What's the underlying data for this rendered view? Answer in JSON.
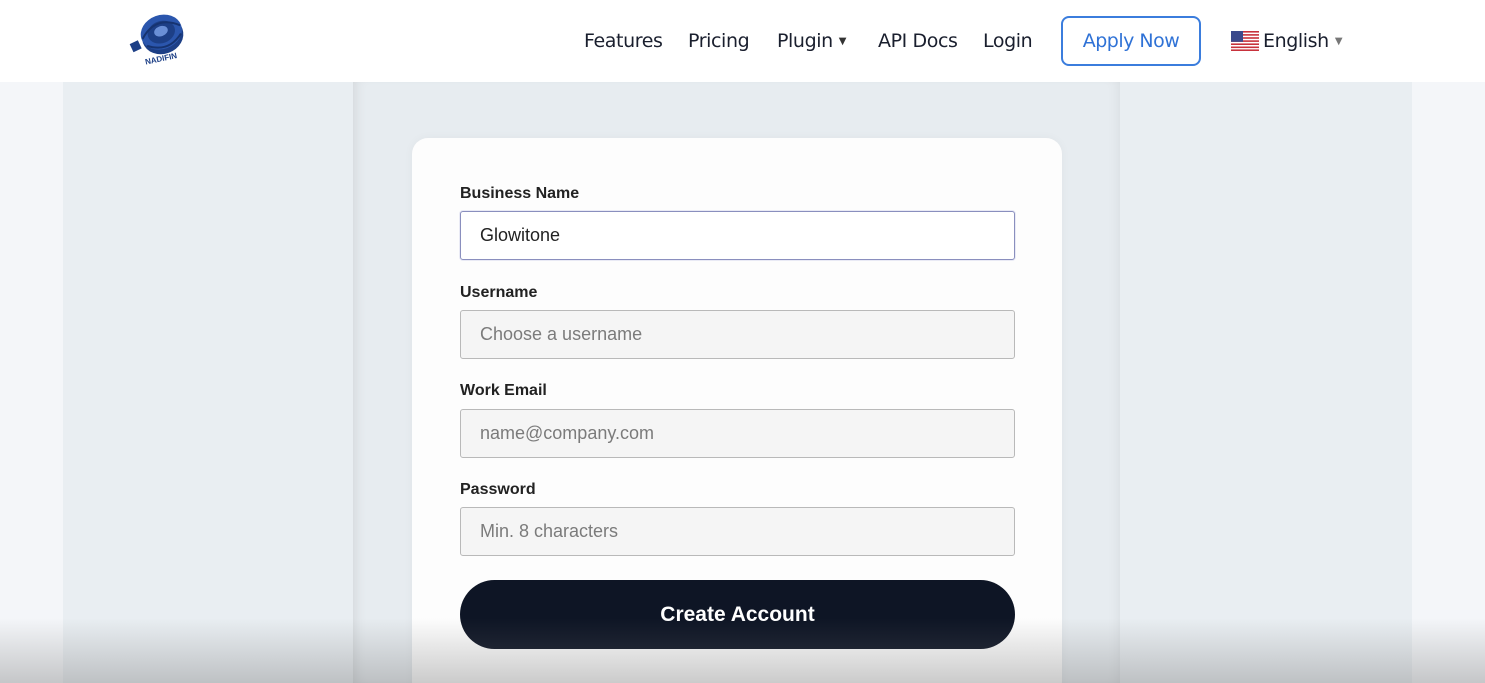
{
  "brand": {
    "logo_text": "NADIFIN"
  },
  "nav": {
    "features": "Features",
    "pricing": "Pricing",
    "plugin": "Plugin",
    "api_docs": "API Docs",
    "login": "Login",
    "apply": "Apply Now",
    "language": "English"
  },
  "form": {
    "business_name": {
      "label": "Business Name",
      "value": "Glowitone"
    },
    "username": {
      "label": "Username",
      "placeholder": "Choose a username"
    },
    "email": {
      "label": "Work Email",
      "placeholder": "name@company.com"
    },
    "password": {
      "label": "Password",
      "placeholder": "Min. 8 characters"
    },
    "submit": "Create Account"
  },
  "colors": {
    "accent": "#3b7ddd",
    "button_dark": "#0e1525",
    "band": "#e9eef2"
  }
}
